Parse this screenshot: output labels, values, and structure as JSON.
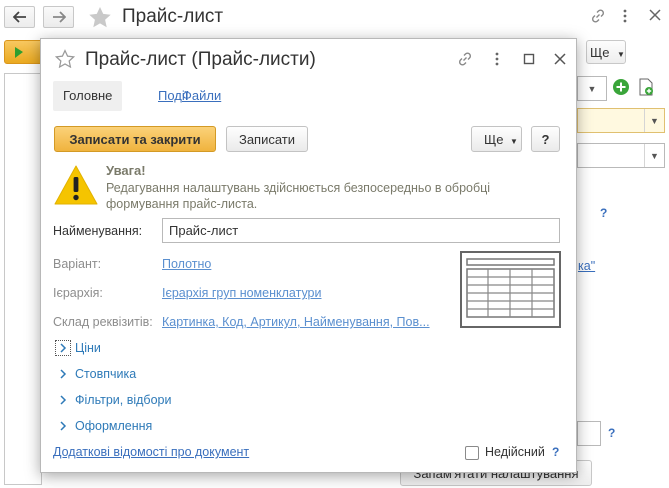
{
  "background": {
    "title": "Прайс-лист",
    "more_label": "Ще",
    "link_fragment": "ка\"",
    "save_settings_button": "Запам'ятати налаштування"
  },
  "dialog": {
    "title": "Прайс-лист (Прайс-листи)",
    "tabs": [
      {
        "label": "Головне",
        "active": true
      },
      {
        "label": "Події",
        "active": false
      },
      {
        "label": "Файли",
        "active": false
      }
    ],
    "toolbar": {
      "save_close_label": "Записати та закрити",
      "save_label": "Записати",
      "more_label": "Ще",
      "help_label": "?"
    },
    "warning": {
      "title": "Увага!",
      "text": "Редагування налаштувань здійснюється безпосередньо в обробці формування прайс-листа."
    },
    "fields": {
      "name_label": "Найменування:",
      "name_value": "Прайс-лист",
      "variant_label": "Варіант:",
      "variant_value": "Полотно",
      "hierarchy_label": "Ієрархія:",
      "hierarchy_value": "Ієрархія груп номенклатури",
      "requisites_label": "Склад реквізитів:",
      "requisites_value": "Картинка, Код, Артикул, Найменування, Пов..."
    },
    "sections": [
      {
        "label": "Ціни",
        "focused": true
      },
      {
        "label": "Стовпчика",
        "focused": false
      },
      {
        "label": "Фільтри, відбори",
        "focused": false
      },
      {
        "label": "Оформлення",
        "focused": false
      }
    ],
    "footer": {
      "details_link": "Додаткові відомості про документ",
      "inactive_label": "Недійсний",
      "inactive_checked": false,
      "help_label": "?"
    }
  },
  "colors": {
    "accent": "#f0b33e",
    "link": "#3a6fbd",
    "warning_yellow": "#f5c400"
  }
}
